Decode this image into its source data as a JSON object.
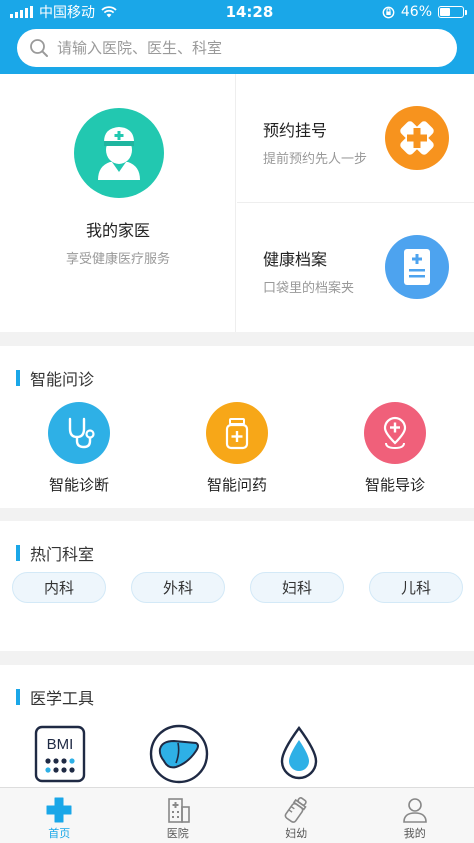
{
  "status_bar": {
    "carrier": "中国移动",
    "time": "14:28",
    "battery": "46%",
    "battery_level": 0.46
  },
  "search": {
    "placeholder": "请输入医院、医生、科室",
    "icon": "search-icon"
  },
  "family_doctor": {
    "title": "我的家医",
    "subtitle": "享受健康医疗服务",
    "icon": "nurse-avatar-icon",
    "color": "#22c8b0"
  },
  "cards": [
    {
      "title": "预约挂号",
      "subtitle": "提前预约先人一步",
      "icon": "hospital-cross-icon",
      "color": "#f7931e"
    },
    {
      "title": "健康档案",
      "subtitle": "口袋里的档案夹",
      "icon": "document-icon",
      "color": "#4da3ef"
    }
  ],
  "smart_consult": {
    "title": "智能问诊",
    "items": [
      {
        "label": "智能诊断",
        "icon": "stethoscope-icon",
        "color": "#2eb0e6"
      },
      {
        "label": "智能问药",
        "icon": "medicine-bottle-icon",
        "color": "#f7a718"
      },
      {
        "label": "智能导诊",
        "icon": "location-pin-icon",
        "color": "#f0607a"
      }
    ]
  },
  "hot_departments": {
    "title": "热门科室",
    "items": [
      "内科",
      "外科",
      "妇科",
      "儿科"
    ]
  },
  "medical_tools": {
    "title": "医学工具",
    "items": [
      {
        "text": "BMI",
        "icon": "bmi-calculator-icon"
      },
      {
        "icon": "liver-icon"
      },
      {
        "icon": "water-drop-icon"
      }
    ]
  },
  "tabbar": {
    "active_color": "#1aa7e8",
    "items": [
      {
        "label": "首页",
        "icon": "home-cross-icon",
        "active": true
      },
      {
        "label": "医院",
        "icon": "hospital-building-icon",
        "active": false
      },
      {
        "label": "妇幼",
        "icon": "baby-bottle-icon",
        "active": false
      },
      {
        "label": "我的",
        "icon": "user-icon",
        "active": false
      }
    ]
  }
}
